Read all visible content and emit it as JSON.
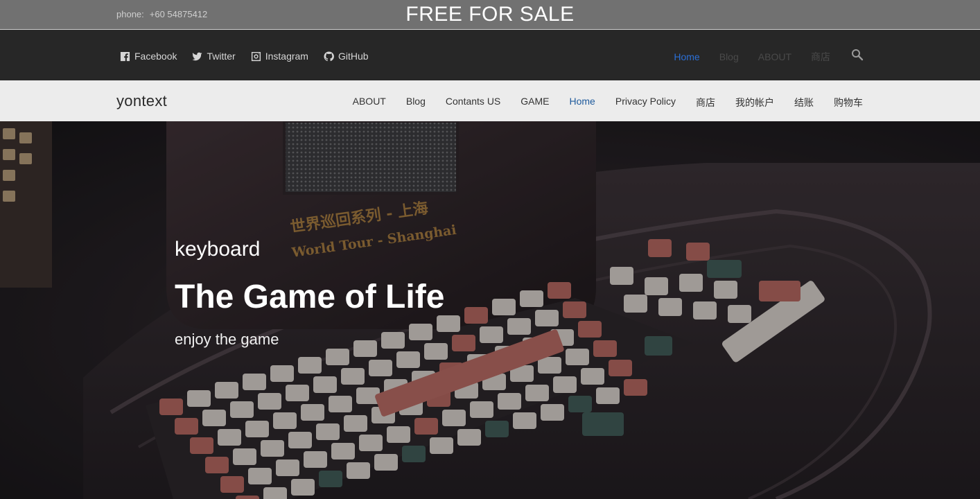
{
  "topbar": {
    "phone_label": "phone:",
    "phone_number": "+60 54875412",
    "banner": "FREE FOR SALE"
  },
  "social": [
    {
      "label": "Facebook",
      "icon": "facebook-icon"
    },
    {
      "label": "Twitter",
      "icon": "twitter-icon"
    },
    {
      "label": "Instagram",
      "icon": "instagram-icon"
    },
    {
      "label": "GitHub",
      "icon": "github-icon"
    }
  ],
  "topnav": {
    "items": [
      "Home",
      "Blog",
      "ABOUT",
      "商店"
    ],
    "active": "Home",
    "search_icon": "search-icon"
  },
  "brand": "yontext",
  "menu": {
    "items": [
      "ABOUT",
      "Blog",
      "Contants US",
      "GAME",
      "Home",
      "Privacy Policy",
      "商店",
      "我的帐户",
      "结账",
      "购物车"
    ],
    "active": "Home"
  },
  "hero": {
    "subtitle": "keyboard",
    "title": "The Game of Life",
    "tagline": "enjoy the game",
    "radio_text_cn": "世界巡回系列 - 上海",
    "radio_text_en": "World Tour - Shanghai"
  },
  "colors": {
    "accent": "#2b6fd6",
    "menu_active": "#1e5a9c",
    "topbar": "#717171",
    "socialbar": "#272727",
    "mainnav": "#ececec"
  }
}
